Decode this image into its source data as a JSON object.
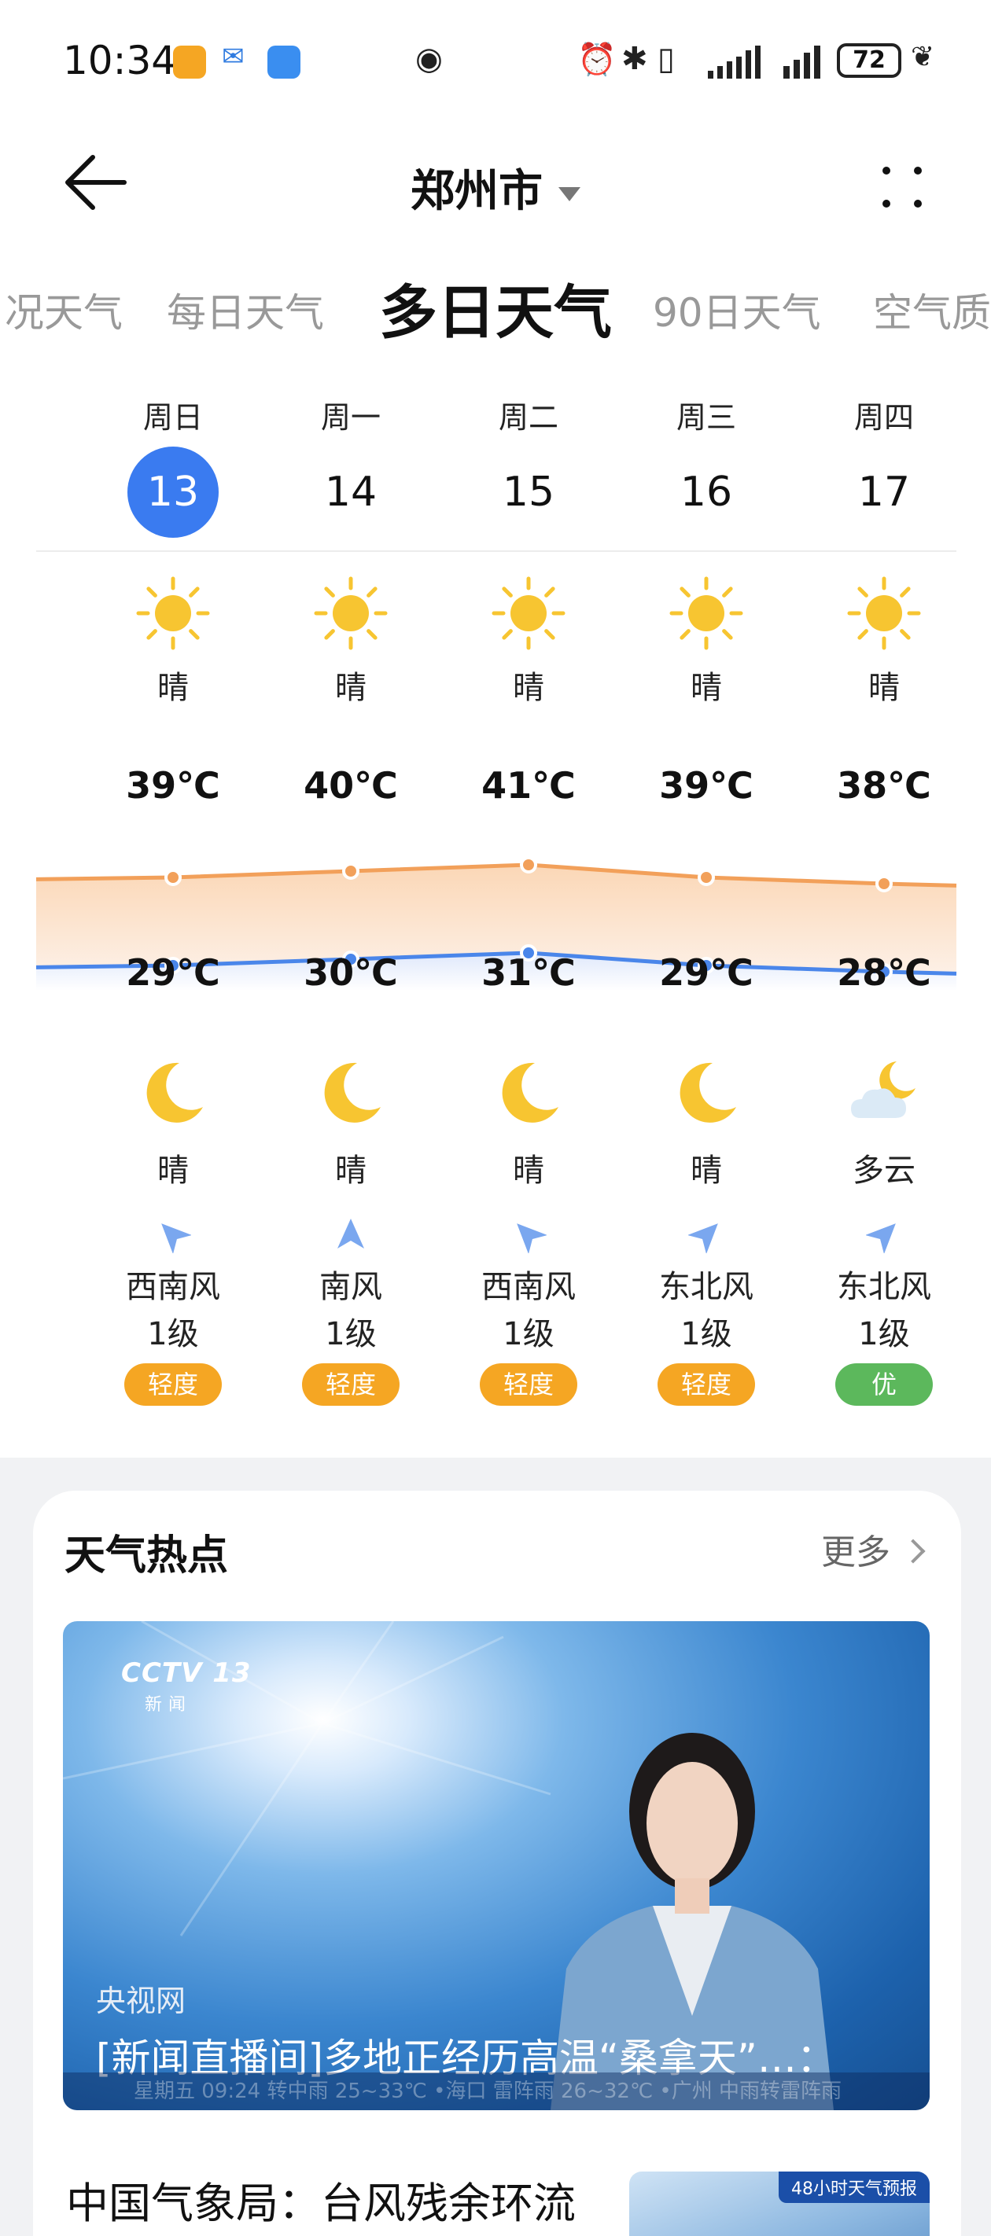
{
  "status_bar": {
    "time": "10:34",
    "battery": "72",
    "icons": [
      "notification-app-icon",
      "chat-bubble-icon",
      "wifi-app-icon",
      "data-saver-icon",
      "alarm-icon",
      "bluetooth-icon",
      "vibrate-icon",
      "signal-icon",
      "signal-icon-2",
      "battery-icon",
      "leaf-icon"
    ]
  },
  "header": {
    "city": "郑州市"
  },
  "tabs": [
    {
      "label": "况天气"
    },
    {
      "label": "每日天气"
    },
    {
      "label": "多日天气"
    },
    {
      "label": "90日天气"
    },
    {
      "label": "空气质"
    }
  ],
  "days": [
    {
      "weekday": "周日",
      "date": "13",
      "day_cond": "晴",
      "high": "39℃",
      "low": "29℃",
      "night_cond": "晴",
      "wind_dir": "西南风",
      "wind_level": "1级",
      "aqi": "轻度"
    },
    {
      "weekday": "周一",
      "date": "14",
      "day_cond": "晴",
      "high": "40℃",
      "low": "30℃",
      "night_cond": "晴",
      "wind_dir": "南风",
      "wind_level": "1级",
      "aqi": "轻度"
    },
    {
      "weekday": "周二",
      "date": "15",
      "day_cond": "晴",
      "high": "41℃",
      "low": "31℃",
      "night_cond": "晴",
      "wind_dir": "西南风",
      "wind_level": "1级",
      "aqi": "轻度"
    },
    {
      "weekday": "周三",
      "date": "16",
      "day_cond": "晴",
      "high": "39℃",
      "low": "29℃",
      "night_cond": "晴",
      "wind_dir": "东北风",
      "wind_level": "1级",
      "aqi": "轻度"
    },
    {
      "weekday": "周四",
      "date": "17",
      "day_cond": "晴",
      "high": "38℃",
      "low": "28℃",
      "night_cond": "多云",
      "wind_dir": "东北风",
      "wind_level": "1级",
      "aqi": "优"
    }
  ],
  "temps": {
    "highs": [
      39,
      40,
      41,
      39,
      38
    ],
    "lows": [
      29,
      30,
      31,
      29,
      28
    ]
  },
  "colors": {
    "accent": "#3a7bf0",
    "high_line": "#f2a05a",
    "low_line": "#4a86ea",
    "aqi_light": "#f5a623",
    "aqi_good": "#5cb85c",
    "sun": "#f7c531"
  },
  "hot": {
    "title": "天气热点",
    "more": "更多",
    "video_logo": "CCTV 13",
    "video_logo_sub": "新闻",
    "video_source": "央视网",
    "video_title": "[新闻直播间]多地正经历高温“桑拿天”…：",
    "ticker": "星期五  09:24  转中雨 25~33℃  •海口 雷阵雨 26~32℃  •广州 中雨转雷阵雨",
    "news2_title": "中国气象局：台风残余环流",
    "news2_badge": "48小时天气预报"
  }
}
